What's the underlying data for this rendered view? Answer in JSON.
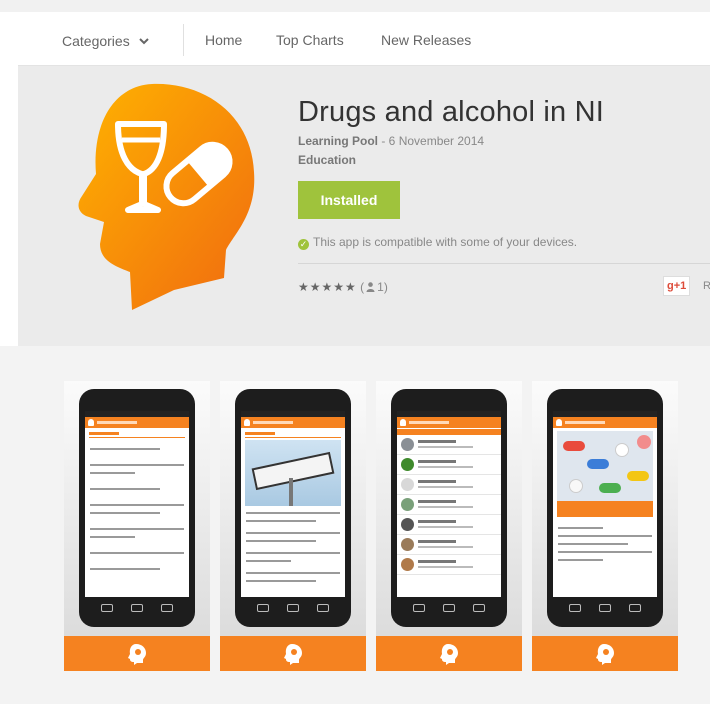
{
  "nav": {
    "items": [
      {
        "label": "Categories",
        "has_dropdown": true
      },
      {
        "label": "Home"
      },
      {
        "label": "Top Charts"
      },
      {
        "label": "New Releases"
      }
    ]
  },
  "app": {
    "title": "Drugs and alcohol in NI",
    "developer": "Learning Pool",
    "date": " - 6 November 2014",
    "category": "Education",
    "install_button": "Installed",
    "compatibility": "This app is compatible with some of your devices.",
    "stars": "★★★★★",
    "rating_count_open": " (",
    "rating_count": "1",
    "rating_count_close": ")",
    "gplus_label": "g+1",
    "gplus_trailing": "R",
    "icon_color": "#f58220"
  },
  "screenshots": {
    "accent_color": "#f58220",
    "screens": [
      {
        "name": "welcome-menu"
      },
      {
        "name": "recovery-model"
      },
      {
        "name": "drug-list"
      },
      {
        "name": "benzodiazepines"
      }
    ]
  },
  "colors": {
    "install_green": "#9fc33c",
    "hero_bg": "#ebebeb",
    "brand_orange": "#f58220"
  }
}
